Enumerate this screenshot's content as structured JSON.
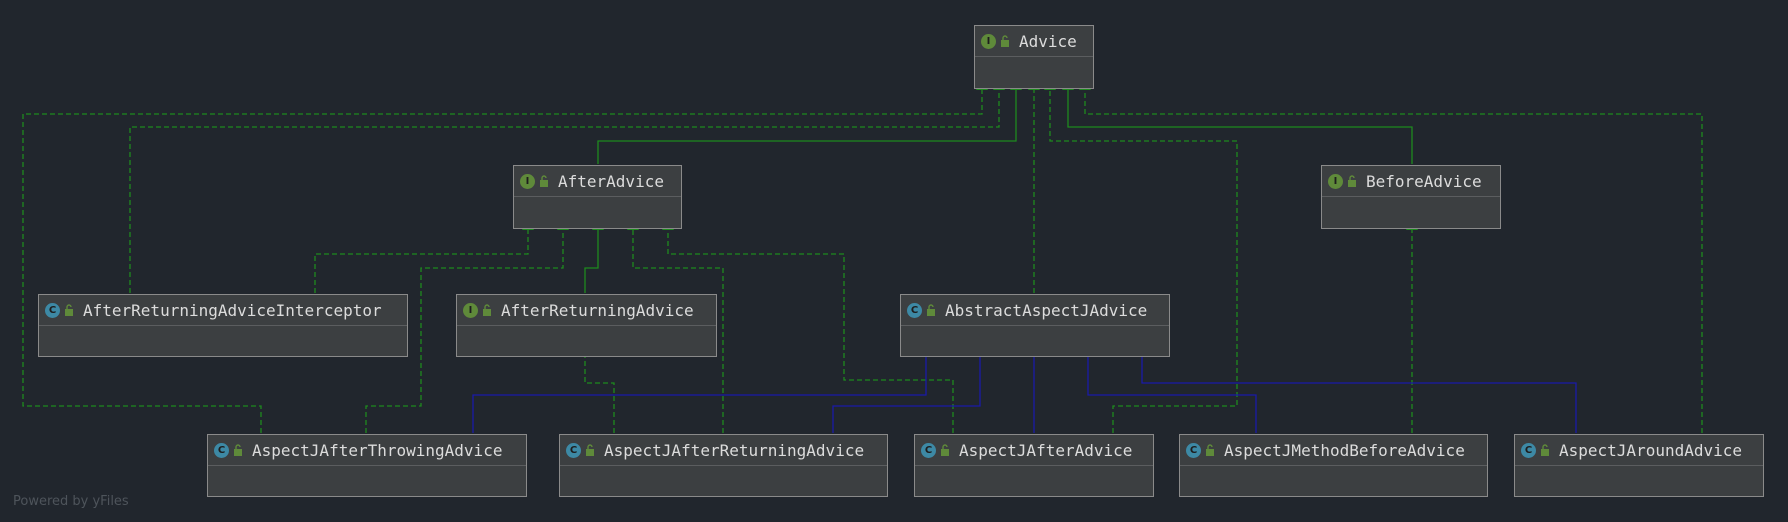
{
  "nodes": [
    {
      "id": "advice",
      "kind": "I",
      "label": "Advice"
    },
    {
      "id": "after_advice",
      "kind": "I",
      "label": "AfterAdvice"
    },
    {
      "id": "before_advice",
      "kind": "I",
      "label": "BeforeAdvice"
    },
    {
      "id": "after_returning_advice_interceptor",
      "kind": "C",
      "label": "AfterReturningAdviceInterceptor"
    },
    {
      "id": "after_returning_advice",
      "kind": "I",
      "label": "AfterReturningAdvice"
    },
    {
      "id": "abstract_aspectj_advice",
      "kind": "C",
      "label": "AbstractAspectJAdvice"
    },
    {
      "id": "aspectj_after_throwing_advice",
      "kind": "C",
      "label": "AspectJAfterThrowingAdvice"
    },
    {
      "id": "aspectj_after_returning_advice",
      "kind": "C",
      "label": "AspectJAfterReturningAdvice"
    },
    {
      "id": "aspectj_after_advice",
      "kind": "C",
      "label": "AspectJAfterAdvice"
    },
    {
      "id": "aspectj_method_before_advice",
      "kind": "C",
      "label": "AspectJMethodBeforeAdvice"
    },
    {
      "id": "aspectj_around_advice",
      "kind": "C",
      "label": "AspectJAroundAdvice"
    }
  ],
  "colors": {
    "implements": "#1e8a1e",
    "extends": "#1a1aa8",
    "background": "#21262d"
  },
  "footer": "Powered by yFiles"
}
